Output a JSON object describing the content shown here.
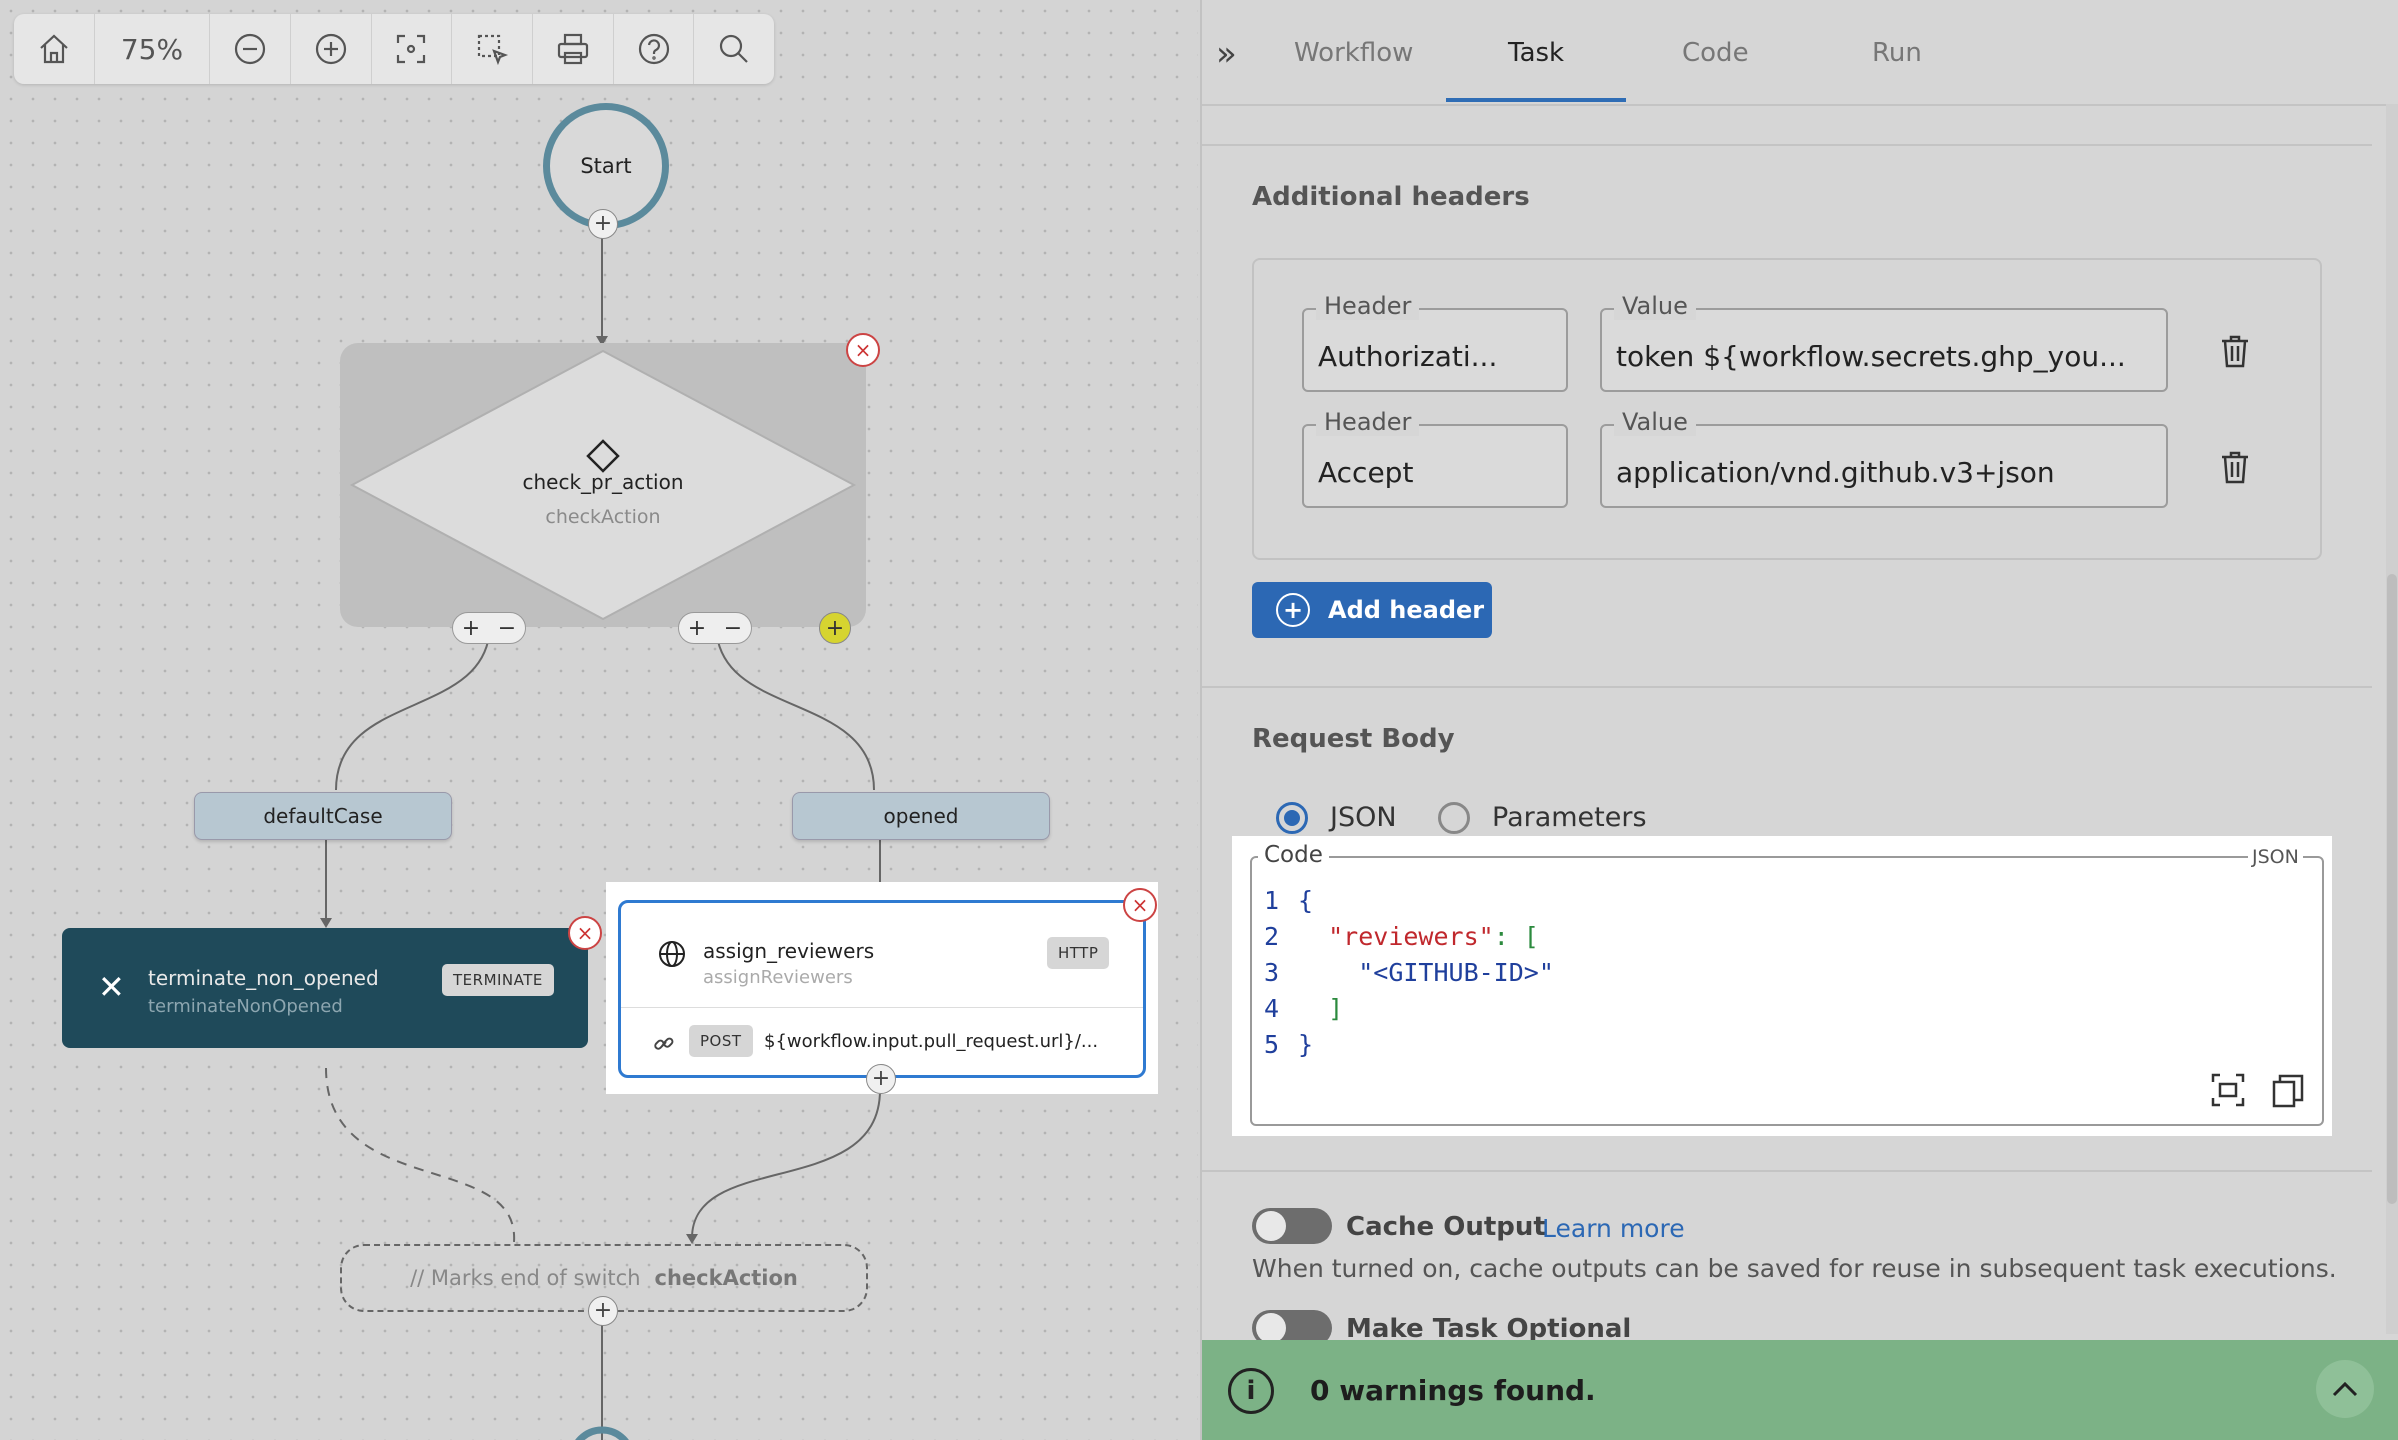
{
  "toolbar": {
    "zoom": "75%"
  },
  "flow": {
    "start": "Start",
    "switch_name": "check_pr_action",
    "switch_ref": "checkAction",
    "cases": [
      "defaultCase",
      "opened"
    ],
    "terminate": {
      "name": "terminate_non_opened",
      "ref": "terminateNonOpened",
      "badge": "TERMINATE"
    },
    "http": {
      "name": "assign_reviewers",
      "ref": "assignReviewers",
      "badge": "HTTP",
      "method": "POST",
      "url": "${workflow.input.pull_request.url}/..."
    },
    "end_switch": {
      "comment": "// Marks end of switch",
      "ref": "checkAction"
    }
  },
  "tabs": [
    "Workflow",
    "Task",
    "Code",
    "Run"
  ],
  "headers": {
    "title": "Additional headers",
    "rows": [
      {
        "header_label": "Header",
        "header": "Authorizati...",
        "value_label": "Value",
        "value": "token ${workflow.secrets.ghp_you..."
      },
      {
        "header_label": "Header",
        "header": "Accept",
        "value_label": "Value",
        "value": "application/vnd.github.v3+json"
      }
    ],
    "add_button": "Add header"
  },
  "body": {
    "title": "Request Body",
    "options": [
      "JSON",
      "Parameters"
    ],
    "selected": "JSON",
    "code_label": "Code",
    "lang_label": "JSON",
    "lines": [
      "{",
      "\"reviewers\"",
      ": [",
      "\"<GITHUB-ID>\"",
      "]",
      "}"
    ],
    "line_numbers": [
      "1",
      "2",
      "3",
      "4",
      "5"
    ]
  },
  "cache": {
    "label": "Cache Output",
    "link": "Learn more",
    "help": "When turned on, cache outputs can be saved for reuse in subsequent task executions."
  },
  "optional": {
    "label": "Make Task Optional"
  },
  "warnings": "0 warnings found."
}
